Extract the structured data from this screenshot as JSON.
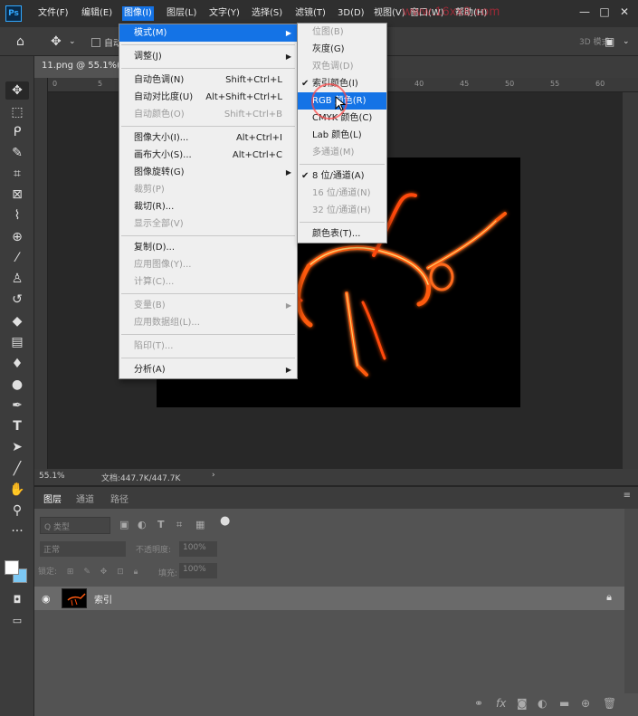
{
  "menubar": {
    "logo": "Ps",
    "items": [
      "文件(F)",
      "编辑(E)",
      "图像(I)",
      "图层(L)",
      "文字(Y)",
      "选择(S)",
      "滤镜(T)",
      "3D(D)",
      "视图(V)",
      "窗口(W)",
      "帮助(H)"
    ],
    "active_index": 2,
    "watermark": "www.16xx8.com"
  },
  "options": {
    "auto_select_label": "自动",
    "three_d_mode": "3D 模式："
  },
  "document": {
    "tab_title": "11.png @ 55.1%(",
    "zoom": "55.1%",
    "doc_size": "文档:447.7K/447.7K",
    "ruler_labels": [
      "0",
      "5",
      "10",
      "15",
      "20",
      "25",
      "30",
      "35",
      "40",
      "45",
      "50",
      "55",
      "60"
    ]
  },
  "image_menu": {
    "items": [
      {
        "label": "模式(M)",
        "submenu": true,
        "highlight": true
      },
      {
        "sep": true
      },
      {
        "label": "调整(J)",
        "submenu": true
      },
      {
        "sep": true
      },
      {
        "label": "自动色调(N)",
        "shortcut": "Shift+Ctrl+L"
      },
      {
        "label": "自动对比度(U)",
        "shortcut": "Alt+Shift+Ctrl+L"
      },
      {
        "label": "自动颜色(O)",
        "shortcut": "Shift+Ctrl+B",
        "disabled": true
      },
      {
        "sep": true
      },
      {
        "label": "图像大小(I)...",
        "shortcut": "Alt+Ctrl+I"
      },
      {
        "label": "画布大小(S)...",
        "shortcut": "Alt+Ctrl+C"
      },
      {
        "label": "图像旋转(G)",
        "submenu": true
      },
      {
        "label": "裁剪(P)",
        "disabled": true
      },
      {
        "label": "裁切(R)..."
      },
      {
        "label": "显示全部(V)",
        "disabled": true
      },
      {
        "sep": true
      },
      {
        "label": "复制(D)..."
      },
      {
        "label": "应用图像(Y)...",
        "disabled": true
      },
      {
        "label": "计算(C)...",
        "disabled": true
      },
      {
        "sep": true
      },
      {
        "label": "变量(B)",
        "submenu": true,
        "disabled": true
      },
      {
        "label": "应用数据组(L)...",
        "disabled": true
      },
      {
        "sep": true
      },
      {
        "label": "陷印(T)...",
        "disabled": true
      },
      {
        "sep": true
      },
      {
        "label": "分析(A)",
        "submenu": true
      }
    ]
  },
  "mode_menu": {
    "items": [
      {
        "label": "位图(B)",
        "disabled": true
      },
      {
        "label": "灰度(G)"
      },
      {
        "label": "双色调(D)",
        "disabled": true
      },
      {
        "label": "索引颜色(I)",
        "checked": true
      },
      {
        "label": "RGB 颜色(R)",
        "highlight": true
      },
      {
        "label": "CMYK 颜色(C)"
      },
      {
        "label": "Lab 颜色(L)"
      },
      {
        "label": "多通道(M)",
        "disabled": true
      },
      {
        "sep": true
      },
      {
        "label": "8 位/通道(A)",
        "checked": true
      },
      {
        "label": "16 位/通道(N)",
        "disabled": true
      },
      {
        "label": "32 位/通道(H)",
        "disabled": true
      },
      {
        "sep": true
      },
      {
        "label": "颜色表(T)..."
      }
    ]
  },
  "layers_panel": {
    "tabs": [
      "图层",
      "通道",
      "路径"
    ],
    "active_tab": 0,
    "filter_placeholder": "Q 类型",
    "blend_mode": "正常",
    "opacity_label": "不透明度:",
    "opacity_value": "100%",
    "lock_label": "锁定:",
    "fill_label": "填充:",
    "fill_value": "100%",
    "layer_name": "索引"
  },
  "colors": {
    "accent": "#1473e6",
    "fg_swatch": "#ffffff",
    "bg_swatch": "#7cc8f4",
    "canvas": "#282828",
    "glow": "#ff6a1a"
  }
}
